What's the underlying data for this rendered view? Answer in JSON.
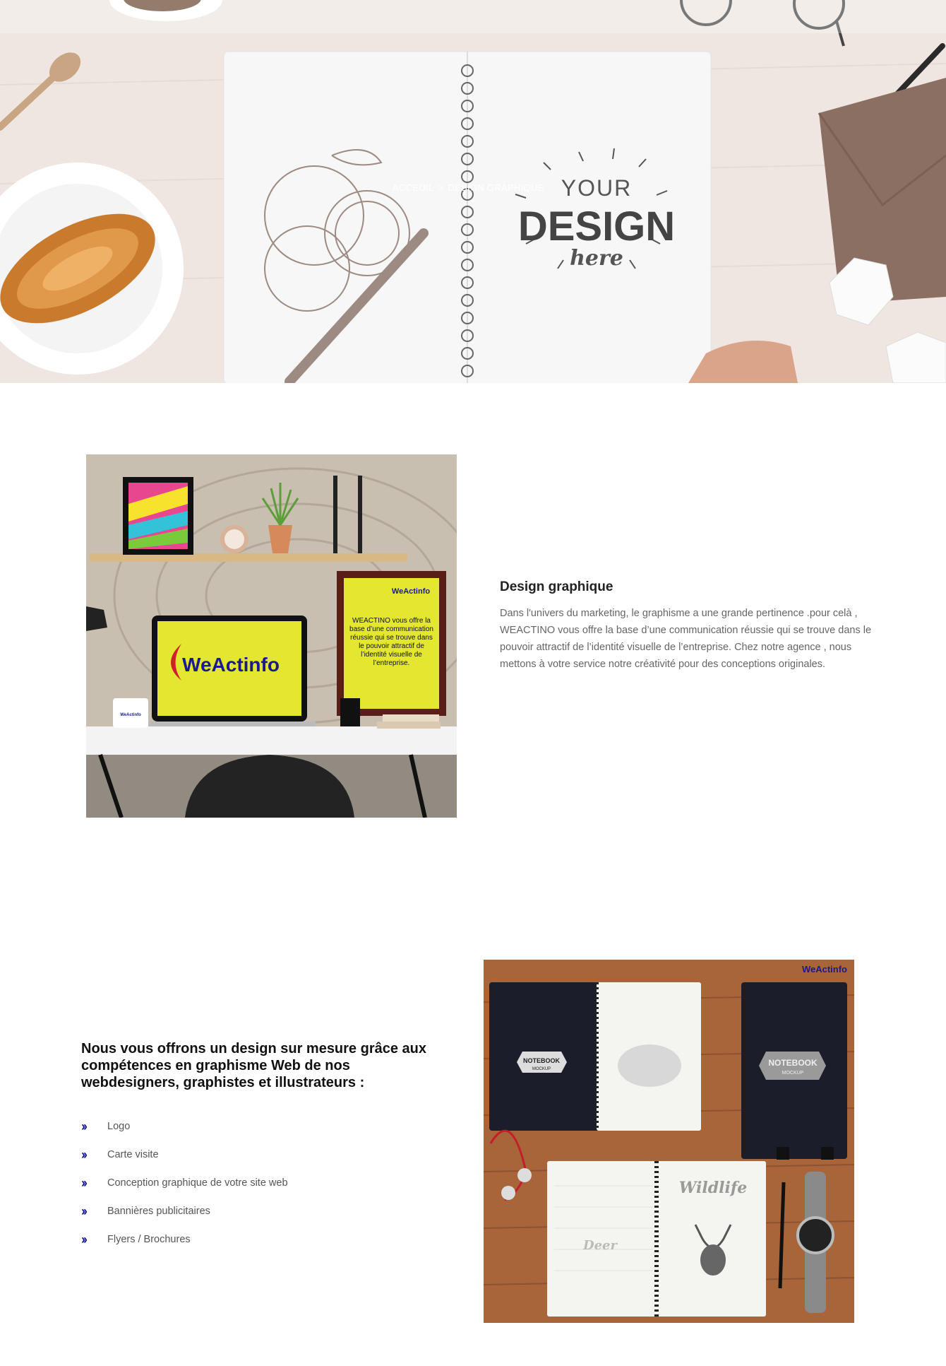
{
  "breadcrumb": {
    "home": "ACCEUIL",
    "separator": ">",
    "current": "DESIGN GRAPHIQUE"
  },
  "hero_notebook": {
    "line1": "YOUR",
    "line2": "DESIGN",
    "line3": "here"
  },
  "section1": {
    "title": "Design graphique",
    "body": "Dans l'univers du marketing, le graphisme a une grande pertinence .pour celà , WEACTINO vous offre la base d’une communication réussie qui se trouve dans le pouvoir attractif de l’identité visuelle de l’entreprise. Chez notre agence , nous mettons à votre service notre créativité pour des conceptions originales.",
    "image": {
      "laptop_brand": "WeActinfo",
      "frame_brand": "WeActinfo",
      "frame_text": "WEACTINO vous offre la base d’une communication réussie qui se trouve dans le pouvoir attractif de l’identité visuelle de l’entreprise.",
      "mug_brand": "WeActinfo"
    }
  },
  "section2": {
    "title": "Nous vous offrons un design sur mesure grâce aux compétences en graphisme Web de nos webdesigners, graphistes et illustrateurs :",
    "bullet_icon": "double-chevron-right-icon",
    "items": [
      "Logo",
      "Carte visite",
      "Conception graphique de votre site web",
      "Bannières publicitaires",
      "Flyers / Brochures"
    ],
    "image": {
      "brand": "WeActinfo",
      "badge_left_1": "NOTEBOOK",
      "badge_left_2": "MOCKUP",
      "badge_right_1": "NOTEBOOK",
      "badge_right_2": "MOCKUP",
      "page_word_1": "Deer",
      "page_word_2": "Wildlife"
    }
  },
  "colors": {
    "accent": "#1a1a8c",
    "yellow": "#e3e72f",
    "text": "#666666",
    "heading": "#222222"
  }
}
